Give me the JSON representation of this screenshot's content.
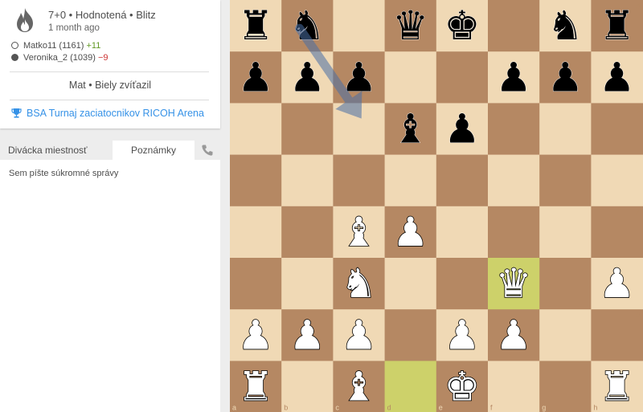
{
  "game": {
    "meta": "7+0 • Hodnotená • Blitz",
    "time_ago": "1 month ago",
    "result": "Mat • Biely zvíťazil",
    "tournament": "BSA Turnaj zaciatocnikov RICOH Arena"
  },
  "players": {
    "white": {
      "name": "Matko11 (1161)",
      "diff": "+11"
    },
    "black": {
      "name": "Veronika_2 (1039)",
      "diff": "−9"
    }
  },
  "tabs": {
    "spectator": "Divácka miestnosť",
    "notes": "Poznámky"
  },
  "notes": {
    "placeholder": "Sem píšte súkromné správy"
  },
  "board": {
    "files": [
      "a",
      "b",
      "c",
      "d",
      "e",
      "f",
      "g",
      "h"
    ],
    "ranks": [
      "8",
      "7",
      "6",
      "5",
      "4",
      "3",
      "2",
      "1"
    ],
    "pieces": [
      [
        "r",
        "n",
        "",
        "q",
        "k",
        "",
        "n",
        "r"
      ],
      [
        "p",
        "p",
        "p",
        "",
        "",
        "p",
        "p",
        "p"
      ],
      [
        "",
        "",
        "",
        "b",
        "p",
        "",
        "",
        ""
      ],
      [
        "",
        "",
        "",
        "",
        "",
        "",
        "",
        ""
      ],
      [
        "",
        "",
        "B",
        "P",
        "",
        "",
        "",
        ""
      ],
      [
        "",
        "",
        "N",
        "",
        "",
        "Q",
        "",
        "P"
      ],
      [
        "P",
        "P",
        "P",
        "",
        "P",
        "P",
        "",
        ""
      ],
      [
        "R",
        "",
        "B",
        "",
        "K",
        "",
        "",
        "R"
      ]
    ],
    "highlights": [
      "d1",
      "f3"
    ],
    "arrow": {
      "from": "b8",
      "to": "c6"
    },
    "colors": {
      "light": "#f0d9b5",
      "dark": "#b58863",
      "highlight": "#cdd16a"
    }
  }
}
